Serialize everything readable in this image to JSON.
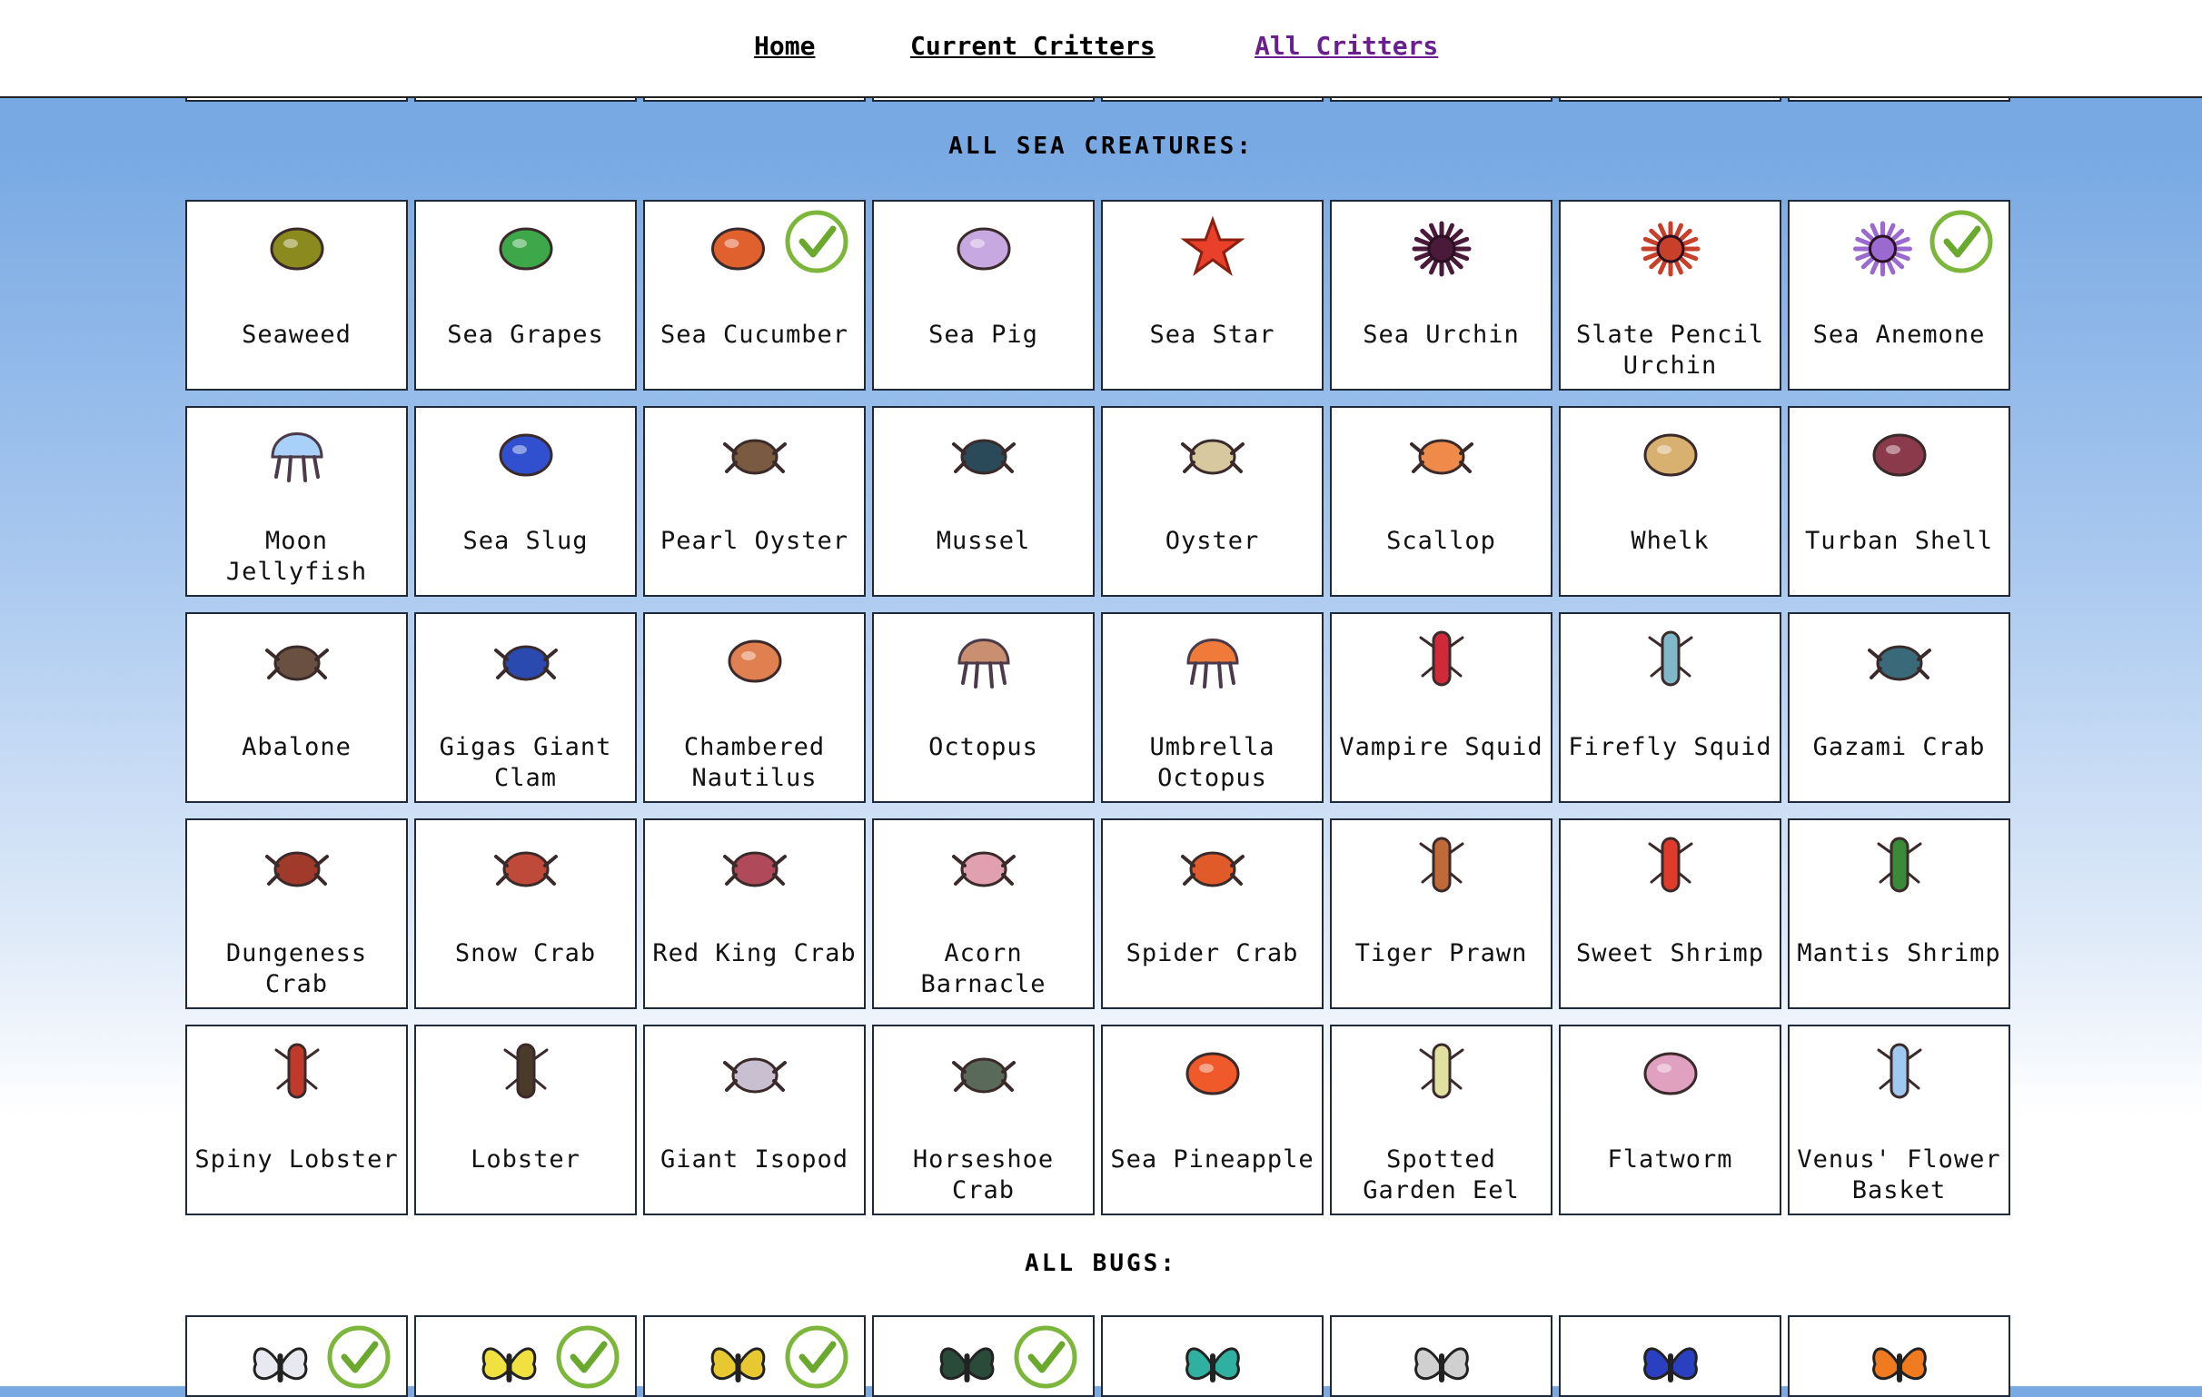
{
  "nav": {
    "home": "Home",
    "current": "Current Critters",
    "all": "All Critters"
  },
  "sea_title": "ALL SEA CREATURES:",
  "bugs_title": "ALL BUGS:",
  "sea": [
    {
      "name": "Seaweed",
      "icon": "seaweed-icon",
      "color": "#8a8a1f",
      "caught": false
    },
    {
      "name": "Sea Grapes",
      "icon": "sea-grapes-icon",
      "color": "#3ca84a",
      "caught": false
    },
    {
      "name": "Sea Cucumber",
      "icon": "sea-cucumber-icon",
      "color": "#e0602e",
      "caught": true
    },
    {
      "name": "Sea Pig",
      "icon": "sea-pig-icon",
      "color": "#c8a8e0",
      "caught": false
    },
    {
      "name": "Sea Star",
      "icon": "sea-star-icon",
      "color": "#e8402a",
      "caught": false
    },
    {
      "name": "Sea Urchin",
      "icon": "sea-urchin-icon",
      "color": "#4a1a3a",
      "caught": false
    },
    {
      "name": "Slate Pencil\nUrchin",
      "icon": "slate-pencil-urchin-icon",
      "color": "#c8402a",
      "caught": false
    },
    {
      "name": "Sea Anemone",
      "icon": "sea-anemone-icon",
      "color": "#9a6ad0",
      "caught": true
    },
    {
      "name": "Moon\nJellyfish",
      "icon": "moon-jellyfish-icon",
      "color": "#a8d0f8",
      "caught": false
    },
    {
      "name": "Sea Slug",
      "icon": "sea-slug-icon",
      "color": "#3050d0",
      "caught": false
    },
    {
      "name": "Pearl Oyster",
      "icon": "pearl-oyster-icon",
      "color": "#7a5a40",
      "caught": false
    },
    {
      "name": "Mussel",
      "icon": "mussel-icon",
      "color": "#2a4a5a",
      "caught": false
    },
    {
      "name": "Oyster",
      "icon": "oyster-icon",
      "color": "#d8c8a0",
      "caught": false
    },
    {
      "name": "Scallop",
      "icon": "scallop-icon",
      "color": "#f08a4a",
      "caught": false
    },
    {
      "name": "Whelk",
      "icon": "whelk-icon",
      "color": "#d8b070",
      "caught": false
    },
    {
      "name": "Turban Shell",
      "icon": "turban-shell-icon",
      "color": "#8a3a4a",
      "caught": false
    },
    {
      "name": "Abalone",
      "icon": "abalone-icon",
      "color": "#6a5040",
      "caught": false
    },
    {
      "name": "Gigas Giant\nClam",
      "icon": "giant-clam-icon",
      "color": "#2a4ab0",
      "caught": false
    },
    {
      "name": "Chambered\nNautilus",
      "icon": "nautilus-icon",
      "color": "#e08050",
      "caught": false
    },
    {
      "name": "Octopus",
      "icon": "octopus-icon",
      "color": "#c89070",
      "caught": false
    },
    {
      "name": "Umbrella\nOctopus",
      "icon": "umbrella-octopus-icon",
      "color": "#f07a3a",
      "caught": false
    },
    {
      "name": "Vampire Squid",
      "icon": "vampire-squid-icon",
      "color": "#d02a3a",
      "caught": false
    },
    {
      "name": "Firefly Squid",
      "icon": "firefly-squid-icon",
      "color": "#80b8c8",
      "caught": false
    },
    {
      "name": "Gazami Crab",
      "icon": "gazami-crab-icon",
      "color": "#3a6a7a",
      "caught": false
    },
    {
      "name": "Dungeness\nCrab",
      "icon": "dungeness-crab-icon",
      "color": "#a03a2a",
      "caught": false
    },
    {
      "name": "Snow Crab",
      "icon": "snow-crab-icon",
      "color": "#c04a3a",
      "caught": false
    },
    {
      "name": "Red King Crab",
      "icon": "red-king-crab-icon",
      "color": "#b04a5a",
      "caught": false
    },
    {
      "name": "Acorn\nBarnacle",
      "icon": "acorn-barnacle-icon",
      "color": "#e0a0b0",
      "caught": false
    },
    {
      "name": "Spider Crab",
      "icon": "spider-crab-icon",
      "color": "#e05a2a",
      "caught": false
    },
    {
      "name": "Tiger Prawn",
      "icon": "tiger-prawn-icon",
      "color": "#c06a3a",
      "caught": false
    },
    {
      "name": "Sweet Shrimp",
      "icon": "sweet-shrimp-icon",
      "color": "#e03a2a",
      "caught": false
    },
    {
      "name": "Mantis Shrimp",
      "icon": "mantis-shrimp-icon",
      "color": "#3a8a3a",
      "caught": false
    },
    {
      "name": "Spiny Lobster",
      "icon": "spiny-lobster-icon",
      "color": "#c03a2a",
      "caught": false
    },
    {
      "name": "Lobster",
      "icon": "lobster-icon",
      "color": "#4a3a2a",
      "caught": false
    },
    {
      "name": "Giant Isopod",
      "icon": "giant-isopod-icon",
      "color": "#c8c0d0",
      "caught": false
    },
    {
      "name": "Horseshoe\nCrab",
      "icon": "horseshoe-crab-icon",
      "color": "#5a6a5a",
      "caught": false
    },
    {
      "name": "Sea Pineapple",
      "icon": "sea-pineapple-icon",
      "color": "#f05a2a",
      "caught": false
    },
    {
      "name": "Spotted\nGarden Eel",
      "icon": "garden-eel-icon",
      "color": "#e0e0a0",
      "caught": false
    },
    {
      "name": "Flatworm",
      "icon": "flatworm-icon",
      "color": "#e0a0c0",
      "caught": false
    },
    {
      "name": "Venus' Flower\nBasket",
      "icon": "venus-flower-basket-icon",
      "color": "#a0c8f0",
      "caught": false
    }
  ],
  "bugs": [
    {
      "icon": "butterfly-white-icon",
      "color": "#e8e8f0",
      "caught": true
    },
    {
      "icon": "butterfly-yellow-icon",
      "color": "#f0e040",
      "caught": true
    },
    {
      "icon": "butterfly-swallowtail-icon",
      "color": "#e8c830",
      "caught": true
    },
    {
      "icon": "butterfly-green-icon",
      "color": "#2a4a3a",
      "caught": true
    },
    {
      "icon": "butterfly-teal-icon",
      "color": "#30b0a0",
      "caught": false
    },
    {
      "icon": "butterfly-striped-icon",
      "color": "#d0d0d0",
      "caught": false
    },
    {
      "icon": "butterfly-blue-icon",
      "color": "#2a40c0",
      "caught": false
    },
    {
      "icon": "butterfly-monarch-icon",
      "color": "#f07a20",
      "caught": false
    }
  ]
}
